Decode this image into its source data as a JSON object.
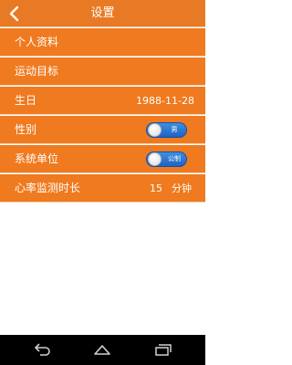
{
  "header": {
    "title": "设置",
    "back_icon": "chevron-left-icon"
  },
  "settings": {
    "profile": {
      "label": "个人资料"
    },
    "goal": {
      "label": "运动目标"
    },
    "birthday": {
      "label": "生日",
      "value": "1988-11-28"
    },
    "gender": {
      "label": "性别",
      "toggle_text": "男"
    },
    "units": {
      "label": "系统单位",
      "toggle_text": "公制"
    },
    "heart_rate": {
      "label": "心率监测时长",
      "value": "15",
      "unit": "分钟"
    }
  },
  "colors": {
    "accent": "#ef7a1f",
    "title_bar": "#e97a25",
    "toggle": "#2a74d4"
  },
  "navbar": {
    "icons": [
      "back-icon",
      "home-icon",
      "recent-apps-icon"
    ]
  }
}
